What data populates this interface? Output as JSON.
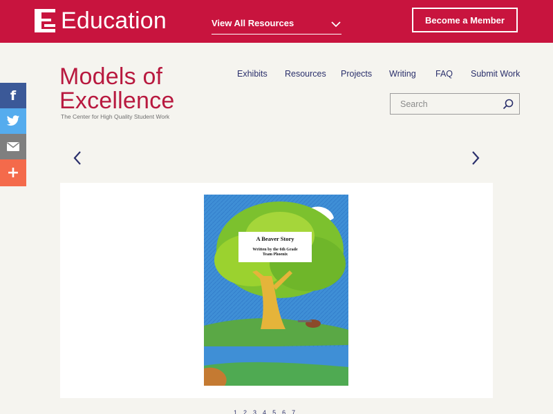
{
  "header": {
    "brand_mark": "EL",
    "brand_name": "Education",
    "resources_dropdown": "View All Resources",
    "member_button": "Become a Member",
    "colors": {
      "bar": "#c8143e",
      "text": "#ffffff"
    }
  },
  "logo": {
    "line1": "Models of",
    "line2": "Excellence",
    "tagline": "The Center for High Quality Student Work",
    "color": "#b8193f"
  },
  "nav": {
    "items": [
      "Exhibits",
      "Resources",
      "Projects",
      "Writing",
      "FAQ",
      "Submit Work"
    ],
    "color": "#2a2f6b"
  },
  "search": {
    "placeholder": "Search"
  },
  "social": [
    {
      "name": "facebook",
      "icon": "facebook-icon",
      "color": "#3b5998"
    },
    {
      "name": "twitter",
      "icon": "twitter-icon",
      "color": "#55acee"
    },
    {
      "name": "email",
      "icon": "email-icon",
      "color": "#7f7f7f"
    },
    {
      "name": "share",
      "icon": "plus-icon",
      "color": "#f46a4b"
    }
  ],
  "carousel": {
    "prev_icon": "chevron-left-icon",
    "next_icon": "chevron-right-icon",
    "cover": {
      "title": "A Beaver Story",
      "byline_1": "Written by the 6th Grade",
      "byline_2": "Team Phoenix"
    },
    "pages": [
      "1",
      "2",
      "3",
      "4",
      "5",
      "6",
      "7"
    ]
  }
}
